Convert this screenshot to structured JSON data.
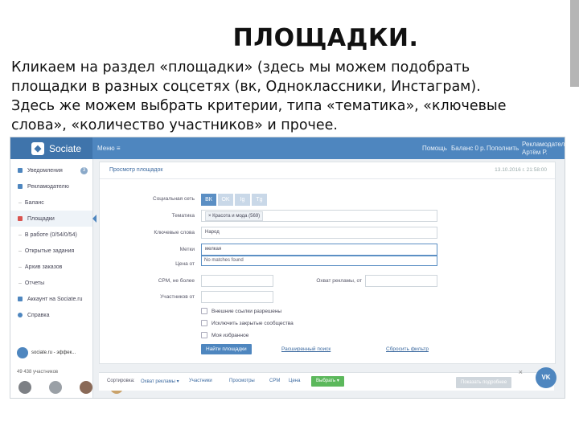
{
  "slide": {
    "title": "ПЛОЩАДКИ.",
    "lines": [
      "Кликаем на раздел «площадки» (здесь мы можем подобрать",
      "площадки в разных соцсетях (вк, Одноклассники, Инстаграм).",
      "Здесь же можем выбрать критерии, типа «тематика», «ключевые",
      "слова», «количество участников» и прочее."
    ]
  },
  "app": {
    "logo_text": "Sociate",
    "topbar": {
      "menu_label": "Меню ≡",
      "help": "Помощь",
      "balance": "Баланс 0 р.",
      "topup": "Пополнить",
      "account": "Рекламодатель",
      "account_sub": "Артём Р."
    },
    "sidebar": {
      "items": [
        {
          "label": "Уведомления",
          "badge": "3"
        },
        {
          "label": "Рекламодателю"
        },
        {
          "label": "Баланс"
        },
        {
          "label": "Площадки"
        },
        {
          "label": "В работе (0/54/0/54)"
        },
        {
          "label": "Открытые задания"
        },
        {
          "label": "Архив заказов"
        },
        {
          "label": "Отчеты"
        },
        {
          "label": "Аккаунт на Sociate.ru"
        },
        {
          "label": "Справка"
        }
      ],
      "promo_title": "sociate.ru - эффек...",
      "members": "49 438 участников"
    },
    "panel": {
      "title": "Просмотр площадок",
      "date": "13.10.2016 г. 21:58:00",
      "labels": {
        "social": "Социальная сеть",
        "topic": "Тематика",
        "keywords": "Ключевые слова",
        "tags": "Метки",
        "price": "Цена от",
        "cpm": "CPM, не более",
        "reach": "Охват рекламы, от",
        "members": "Участников от"
      },
      "social_icons": [
        "ВК",
        "OK",
        "Ig",
        "Tg"
      ],
      "topic_value": "× Красота и мода (569)",
      "keywords_value": "Народ",
      "tags_value": "мелкая",
      "no_matches": "No matches found",
      "checkboxes": [
        "Внешние ссылки разрешены",
        "Исключить закрытые сообщества",
        "Моя избранное"
      ],
      "find_button": "Найти площадки",
      "advanced_link": "Расширенный поиск",
      "reset_link": "Сбросить фильтр"
    },
    "bottom": {
      "sort_label": "Сортировка:",
      "items": [
        "Охват рекламы ▾",
        "Участники",
        "Просмотры",
        "CPM",
        "Цена"
      ],
      "choose": "Выбрать ▾",
      "show_button": "Показать подробнее"
    },
    "vk_label": "VK",
    "close_glyph": "×"
  }
}
